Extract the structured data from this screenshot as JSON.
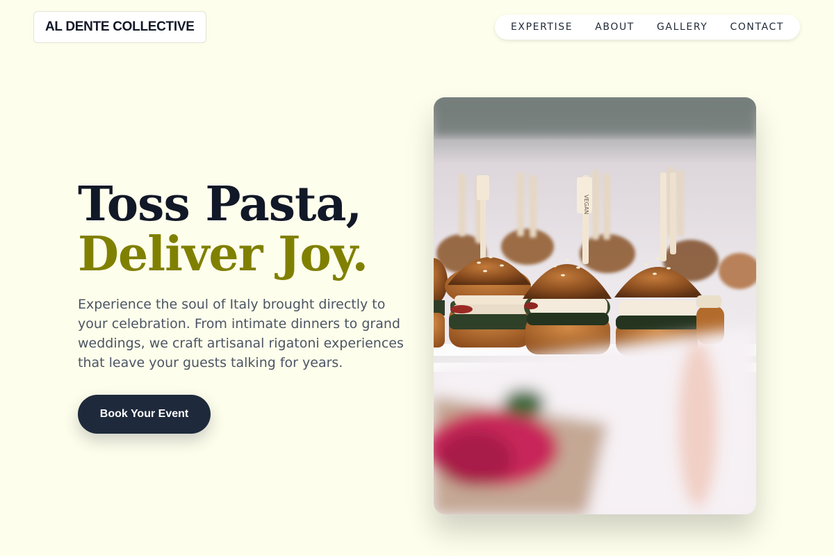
{
  "brand": {
    "name": "AL DENTE COLLECTIVE"
  },
  "nav": {
    "items": [
      "EXPERTISE",
      "ABOUT",
      "GALLERY",
      "CONTACT"
    ]
  },
  "hero": {
    "title_line1": "Toss Pasta,",
    "title_line2": "Deliver Joy.",
    "description": "Experience the soul of Italy brought directly to your celebration. From intimate dinners to grand weddings, we craft artisanal rigatoni experiences that leave your guests talking for years.",
    "cta_label": "Book Your Event"
  },
  "photo": {
    "subject": "sliders-photo",
    "pick_label": "VEGAN"
  },
  "colors": {
    "background": "#fefeec",
    "accent": "#808000",
    "dark": "#1e293b",
    "heading": "#111827",
    "body_text": "#4b5563"
  }
}
